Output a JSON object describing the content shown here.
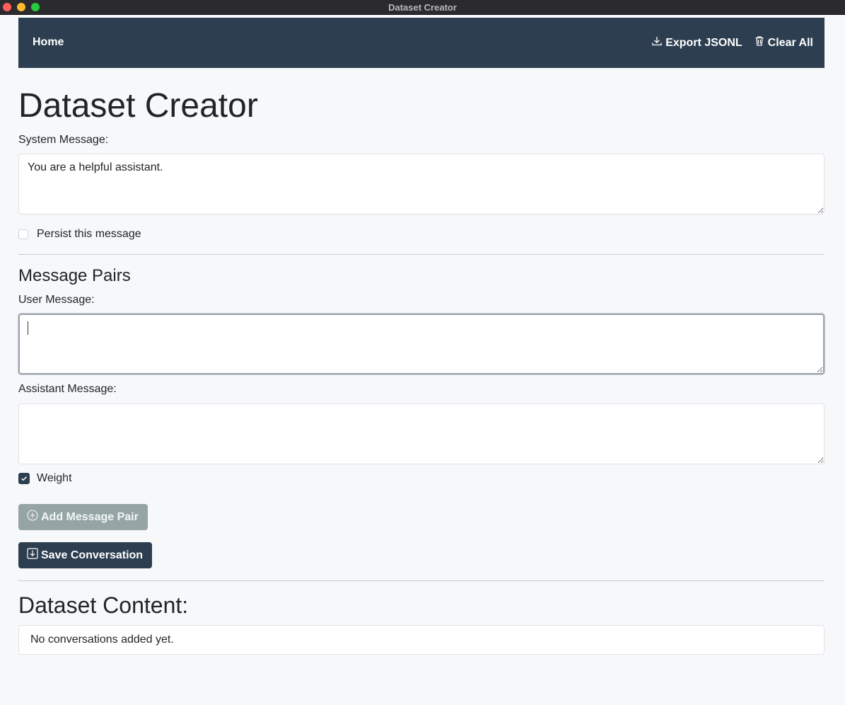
{
  "window": {
    "title": "Dataset Creator"
  },
  "navbar": {
    "home": "Home",
    "export": {
      "label": "Export JSONL",
      "icon": "download-icon"
    },
    "clear": {
      "label": "Clear All",
      "icon": "trash-icon"
    }
  },
  "page": {
    "title": "Dataset Creator"
  },
  "system": {
    "label": "System Message:",
    "value": "You are a helpful assistant.",
    "persist_label": "Persist this message",
    "persist_checked": false
  },
  "pairs": {
    "heading": "Message Pairs",
    "user_label": "User Message:",
    "user_value": "",
    "assistant_label": "Assistant Message:",
    "assistant_value": "",
    "weight_label": "Weight",
    "weight_checked": true
  },
  "buttons": {
    "add_pair": "Add Message Pair",
    "save": "Save Conversation"
  },
  "dataset": {
    "heading": "Dataset Content:",
    "empty": "No conversations added yet."
  },
  "colors": {
    "navbar": "#2c3e50",
    "add_button": "#95a5a6",
    "save_button": "#2c3e50"
  }
}
